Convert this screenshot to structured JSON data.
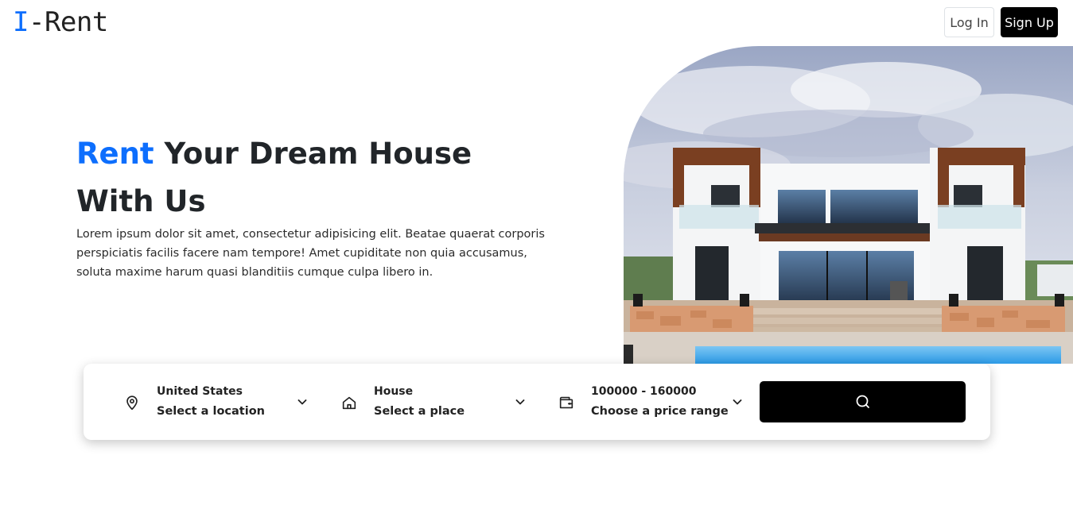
{
  "brand": {
    "logo_prefix": "I",
    "logo_rest": "-Rent",
    "accent_color": "#0d6efd"
  },
  "nav": {
    "login_label": "Log In",
    "signup_label": "Sign Up"
  },
  "hero": {
    "title_accent": "Rent",
    "title_rest": " Your Dream House With Us",
    "description": "Lorem ipsum dolor sit amet, consectetur adipisicing elit. Beatae quaerat corporis perspiciatis facilis facere nam tempore! Amet cupiditate non quia accusamus, soluta maxime harum quasi blanditiis cumque culpa libero in."
  },
  "search": {
    "location": {
      "value": "United States",
      "label": "Select a location",
      "icon": "map-pin-icon"
    },
    "place": {
      "value": "House",
      "label": "Select a place",
      "icon": "home-icon"
    },
    "price": {
      "value": "100000 - 160000",
      "label": "Choose a price range",
      "icon": "wallet-icon"
    },
    "button_icon": "search-icon"
  }
}
